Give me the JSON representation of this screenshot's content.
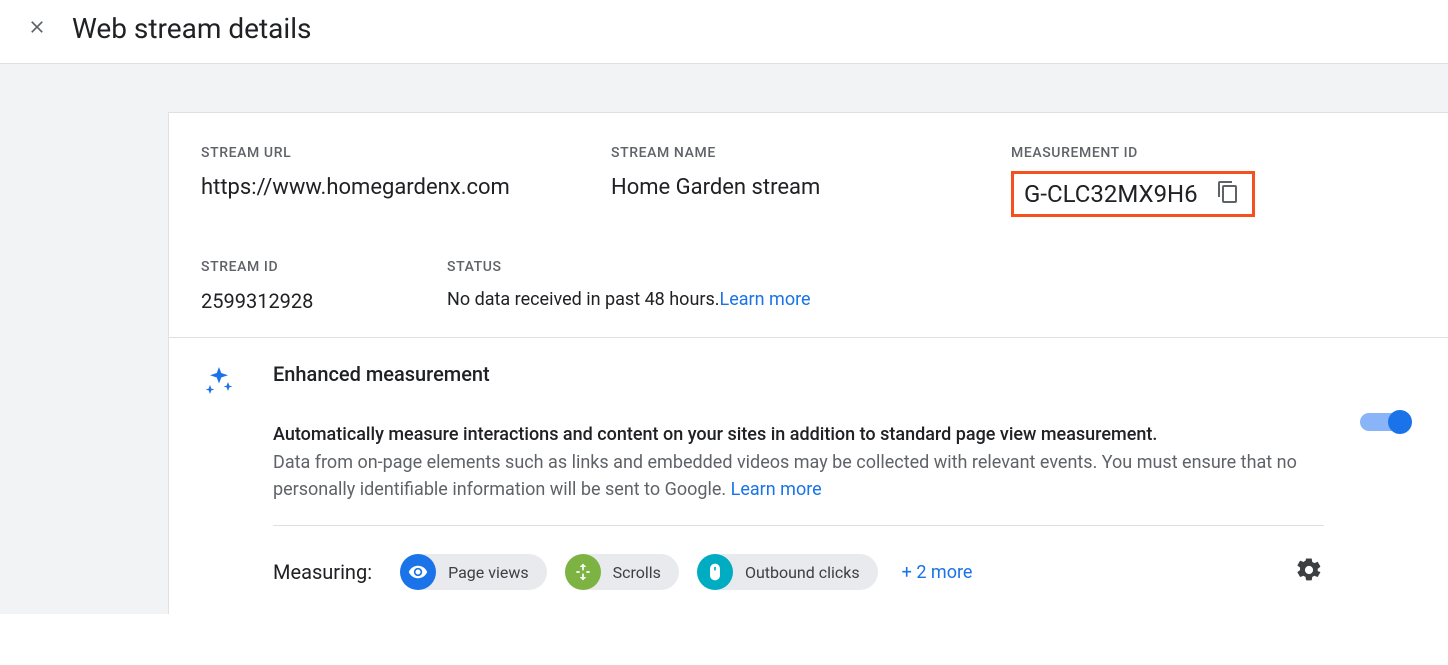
{
  "header": {
    "title": "Web stream details"
  },
  "stream": {
    "url_label": "STREAM URL",
    "url_value": "https://www.homegardenx.com",
    "name_label": "STREAM NAME",
    "name_value": "Home Garden stream",
    "mid_label": "MEASUREMENT ID",
    "mid_value": "G-CLC32MX9H6",
    "id_label": "STREAM ID",
    "id_value": "2599312928",
    "status_label": "STATUS",
    "status_value": "No data received in past 48 hours.",
    "status_learn": "Learn more"
  },
  "enhanced": {
    "title": "Enhanced measurement",
    "line1": "Automatically measure interactions and content on your sites in addition to standard page view measurement.",
    "line2": "Data from on-page elements such as links and embedded videos may be collected with relevant events. You must ensure that no personally identifiable information will be sent to Google.",
    "learn": "Learn more",
    "measuring_label": "Measuring:",
    "chips": [
      {
        "label": "Page views",
        "color": "blue"
      },
      {
        "label": "Scrolls",
        "color": "green"
      },
      {
        "label": "Outbound clicks",
        "color": "cyan"
      }
    ],
    "more": "+ 2 more"
  }
}
